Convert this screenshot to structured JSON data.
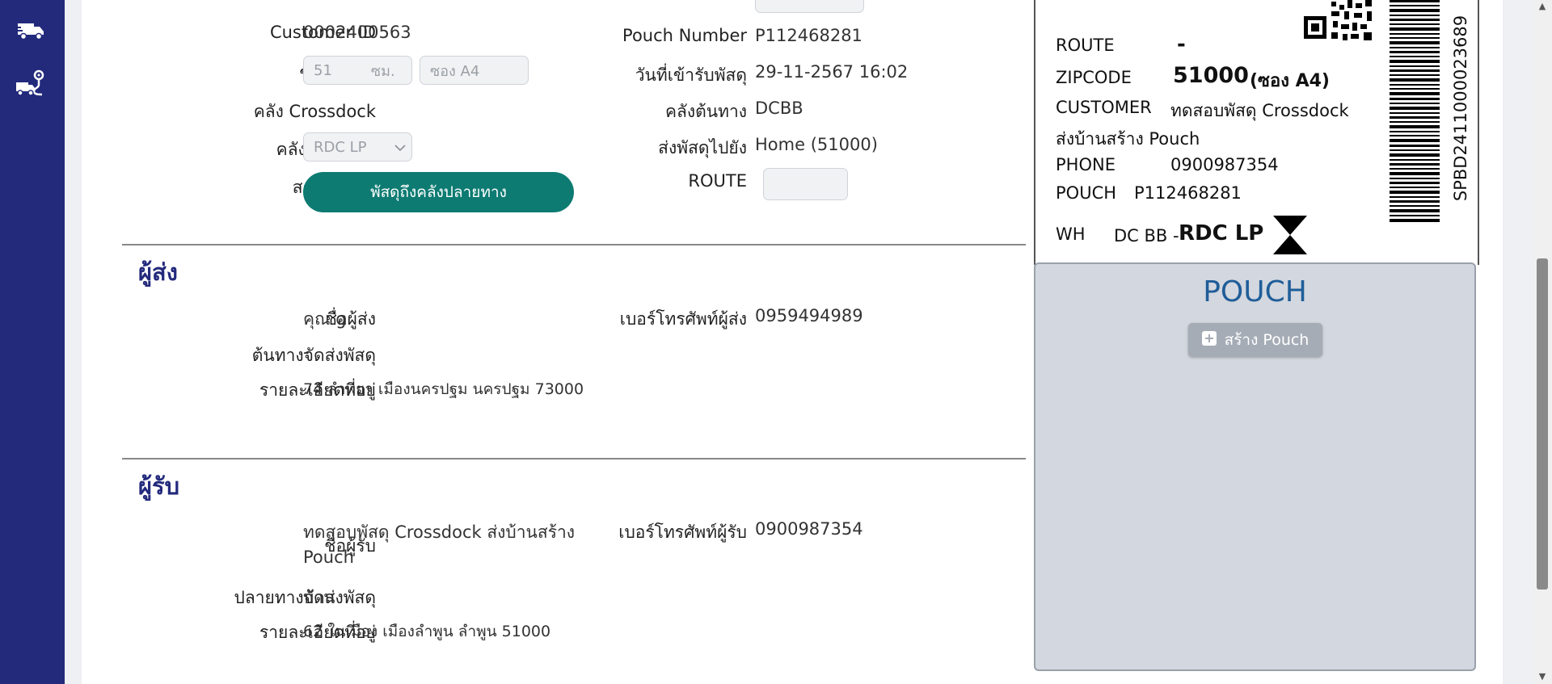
{
  "parcel": {
    "customer_id_label": "Customer ID",
    "customer_id": "0002400563",
    "size_label": "ขนาดพัสดุ",
    "size_value": "51",
    "size_unit": "ซม.",
    "envelope_value": "ซอง A4",
    "crossdock_label": "คลัง Crossdock",
    "dest_wh_label": "คลังปลายทาง",
    "dest_wh_value": "RDC LP",
    "status_label": "สถานะพัสดุ",
    "status_value": "พัสดุถึงคลังปลายทาง",
    "pouch_number_label": "Pouch Number",
    "pouch_number": "P112468281",
    "received_label": "วันที่เข้ารับพัสดุ",
    "received_value": "29-11-2567 16:02",
    "origin_wh_label": "คลังต้นทาง",
    "origin_wh_value": "DCBB",
    "send_to_label": "ส่งพัสดุไปยัง",
    "send_to_value": "Home (51000)",
    "route_label": "ROUTE",
    "route_value": ""
  },
  "sender": {
    "title": "ผู้ส่ง",
    "name_label": "ชื่อผู้ส่ง",
    "name_value": "คุณ g",
    "phone_label": "เบอร์โทรศัพท์ผู้ส่ง",
    "phone_value": "0959494989",
    "origin_label": "ต้นทางจัดส่งพัสดุ",
    "origin_value": "-",
    "address_label": "รายละเอียดที่อยู่",
    "address_value": "74 ลำพยา เมืองนครปฐม นครปฐม 73000"
  },
  "receiver": {
    "title": "ผู้รับ",
    "name_label": "ชื่อผู้รับ",
    "name_value_line1": "ทดสอบพัสดุ Crossdock ส่งบ้านสร้าง",
    "name_value_line2": "Pouch",
    "phone_label": "เบอร์โทรศัพท์ผู้รับ",
    "phone_value": "0900987354",
    "dest_label": "ปลายทางจัดส่งพัสดุ",
    "dest_value": "บ้าน",
    "address_label": "รายละเอียดที่อยู่",
    "address_value": "62 ในเมือง เมืองลำพูน ลำพูน 51000"
  },
  "label_card": {
    "route_key": "ROUTE",
    "route_val": "-",
    "zip_key": "ZIPCODE",
    "zip_val": "51000",
    "zip_extra": "(ซอง A4)",
    "customer_key": "CUSTOMER",
    "customer_val": "ทดสอบพัสดุ Crossdock",
    "customer_val_line2": "ส่งบ้านสร้าง Pouch",
    "phone_key": "PHONE",
    "phone_val": "0900987354",
    "pouch_key": "POUCH",
    "pouch_val": "P112468281",
    "wh_key": "WH",
    "wh_from": "DC BB -",
    "wh_to": "RDC LP",
    "barcode_text": "SPBD2411000023689"
  },
  "pouch_panel": {
    "title": "POUCH",
    "create_label": "สร้าง Pouch"
  },
  "colors": {
    "sidebar": "#232a7c",
    "status_pill": "#0d7b72",
    "section_title": "#232a7c",
    "pouch_title": "#1f5d99"
  }
}
